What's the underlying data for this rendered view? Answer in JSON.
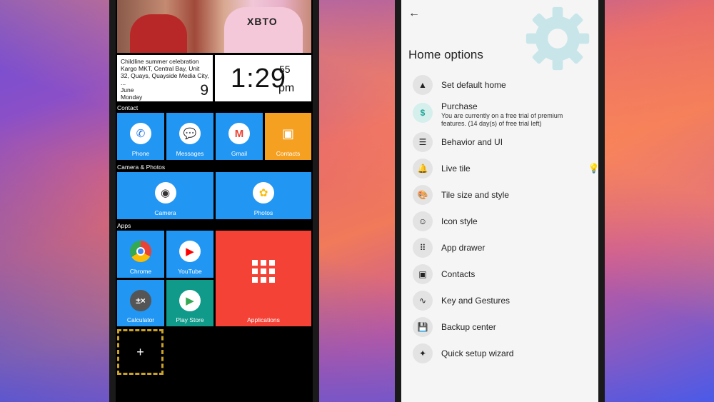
{
  "launcher": {
    "calendar": {
      "event": "Childline summer celebration Kargo MKT, Central Bay, Unit 32, Quays, Quayside Media City, ...",
      "month": "June",
      "weekday": "Monday",
      "day": "9"
    },
    "clock": {
      "time": "1:29",
      "seconds": "55",
      "ampm": "pm"
    },
    "photo_text": "XBTO",
    "sections": {
      "contact": "Contact",
      "camera_photos": "Camera & Photos",
      "apps": "Apps"
    },
    "tiles": {
      "phone": "Phone",
      "messages": "Messages",
      "gmail": "Gmail",
      "contacts": "Contacts",
      "camera": "Camera",
      "photos": "Photos",
      "chrome": "Chrome",
      "youtube": "YouTube",
      "applications": "Applications",
      "calculator": "Calculator",
      "play_store": "Play Store",
      "add": "+"
    },
    "colors": {
      "tile_blue": "#2196f3",
      "tile_orange": "#f5a020",
      "tile_red": "#f44336",
      "tile_teal": "#0f9a8a"
    }
  },
  "settings": {
    "title": "Home options",
    "back_icon": "arrow-back-icon",
    "items": [
      {
        "icon": "warning-icon",
        "label": "Set default home"
      },
      {
        "icon": "dollar-icon",
        "label": "Purchase",
        "sub": "You are currently on a free trial of premium features. (14 day(s) of free trial left)"
      },
      {
        "icon": "sliders-icon",
        "label": "Behavior and UI"
      },
      {
        "icon": "bell-icon",
        "label": "Live tile"
      },
      {
        "icon": "palette-icon",
        "label": "Tile size and style"
      },
      {
        "icon": "face-icon",
        "label": "Icon style"
      },
      {
        "icon": "grid-icon",
        "label": "App drawer"
      },
      {
        "icon": "contact-card-icon",
        "label": "Contacts"
      },
      {
        "icon": "gesture-icon",
        "label": "Key and Gestures"
      },
      {
        "icon": "save-icon",
        "label": "Backup center"
      },
      {
        "icon": "magic-wand-icon",
        "label": "Quick setup wizard"
      }
    ],
    "colors": {
      "accent": "#26a69a",
      "gear": "#c8e6ea"
    }
  }
}
